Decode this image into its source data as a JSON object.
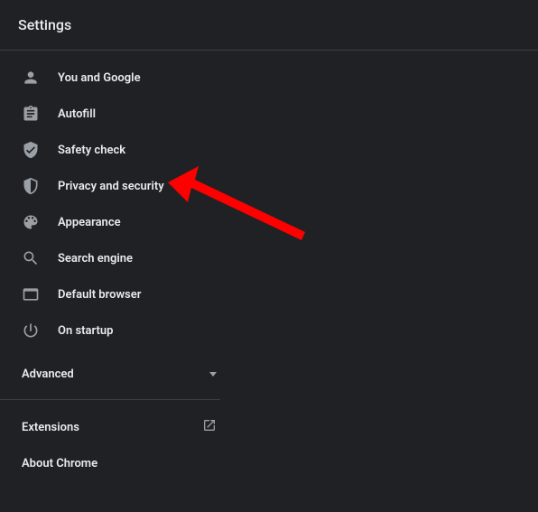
{
  "header": {
    "title": "Settings"
  },
  "sidebar": {
    "items": [
      {
        "label": "You and Google"
      },
      {
        "label": "Autofill"
      },
      {
        "label": "Safety check"
      },
      {
        "label": "Privacy and security"
      },
      {
        "label": "Appearance"
      },
      {
        "label": "Search engine"
      },
      {
        "label": "Default browser"
      },
      {
        "label": "On startup"
      }
    ],
    "advanced_label": "Advanced",
    "extensions_label": "Extensions",
    "about_label": "About Chrome"
  }
}
